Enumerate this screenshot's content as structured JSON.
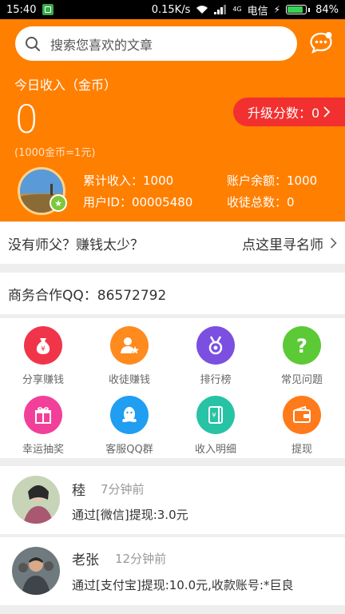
{
  "status_bar": {
    "time": "15:40",
    "speed": "0.15K/s",
    "network": "4G",
    "carrier": "电信",
    "battery": "84%",
    "battery_level": 0.84
  },
  "header": {
    "search_placeholder": "搜索您喜欢的文章",
    "today_label": "今日收入（金币）",
    "today_value": "0",
    "rate_note": "(1000金币=1元)",
    "upgrade_label": "升级分数：0",
    "cumulative_income": "累计收入：1000",
    "account_balance": "账户余额：1000",
    "user_id": "用户ID：00005480",
    "disciples_total": "收徒总数：0"
  },
  "master_row": {
    "left": "没有师父？赚钱太少？",
    "right": "点这里寻名师"
  },
  "business_row": {
    "label": "商务合作QQ：86572792"
  },
  "grid": {
    "items": [
      {
        "label": "分享赚钱",
        "icon": "money-bag-icon",
        "color": "#f0354a"
      },
      {
        "label": "收徒赚钱",
        "icon": "user-star-icon",
        "color": "#ff8a1e"
      },
      {
        "label": "排行榜",
        "icon": "medal-icon",
        "color": "#7b4fe0"
      },
      {
        "label": "常见问题",
        "icon": "question-icon",
        "color": "#5cc936"
      },
      {
        "label": "幸运抽奖",
        "icon": "gift-icon",
        "color": "#f2409a"
      },
      {
        "label": "客服QQ群",
        "icon": "qq-icon",
        "color": "#1f9ef2"
      },
      {
        "label": "收入明细",
        "icon": "ledger-icon",
        "color": "#27c3a4"
      },
      {
        "label": "提现",
        "icon": "wallet-icon",
        "color": "#ff7a1a"
      }
    ]
  },
  "feed": [
    {
      "name": "稑",
      "time": "7分钟前",
      "text": "通过[微信]提现:3.0元"
    },
    {
      "name": "老张",
      "time": "12分钟前",
      "text": "通过[支付宝]提现:10.0元,收款账号:*巨良"
    }
  ]
}
